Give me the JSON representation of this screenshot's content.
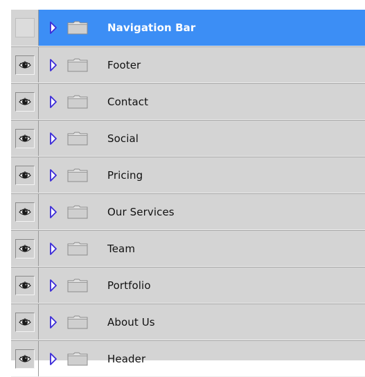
{
  "layers_panel": {
    "colors": {
      "selected_background": "#3c8ef5",
      "row_background": "#d4d4d4",
      "arrow_color": "#3a2ad8",
      "label_color": "#111111",
      "selected_label_color": "#ffffff"
    },
    "layers": [
      {
        "label": "Navigation Bar",
        "visible": false,
        "selected": true,
        "type": "folder",
        "expanded": false
      },
      {
        "label": "Footer",
        "visible": true,
        "selected": false,
        "type": "folder",
        "expanded": false
      },
      {
        "label": "Contact",
        "visible": true,
        "selected": false,
        "type": "folder",
        "expanded": false
      },
      {
        "label": "Social",
        "visible": true,
        "selected": false,
        "type": "folder",
        "expanded": false
      },
      {
        "label": "Pricing",
        "visible": true,
        "selected": false,
        "type": "folder",
        "expanded": false
      },
      {
        "label": "Our Services",
        "visible": true,
        "selected": false,
        "type": "folder",
        "expanded": false
      },
      {
        "label": "Team",
        "visible": true,
        "selected": false,
        "type": "folder",
        "expanded": false
      },
      {
        "label": "Portfolio",
        "visible": true,
        "selected": false,
        "type": "folder",
        "expanded": false
      },
      {
        "label": "About Us",
        "visible": true,
        "selected": false,
        "type": "folder",
        "expanded": false
      },
      {
        "label": "Header",
        "visible": true,
        "selected": false,
        "type": "folder",
        "expanded": false
      }
    ],
    "icons": {
      "visibility": "eye-icon",
      "expand": "disclosure-triangle-icon",
      "group": "folder-icon"
    }
  }
}
